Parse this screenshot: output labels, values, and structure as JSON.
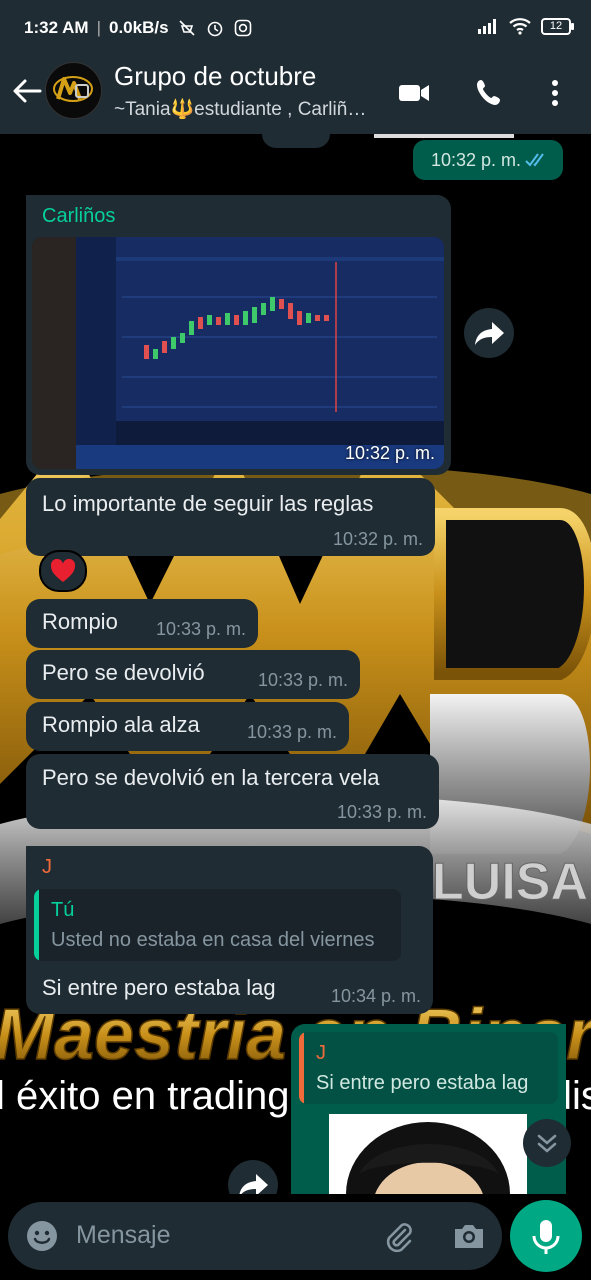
{
  "status_bar": {
    "time": "1:32 AM",
    "speed": "0.0kB/s",
    "battery": "12"
  },
  "header": {
    "title": "Grupo de octubre",
    "subtitle": "~Tania🔱estudiante , Carliñ…"
  },
  "messages": [
    {
      "kind": "outgoing_time",
      "time": "10:32 p. m."
    },
    {
      "kind": "image",
      "sender": "Carliños",
      "time": "10:32 p. m."
    },
    {
      "kind": "text",
      "text": "Lo importante de seguir las reglas",
      "time": "10:32 p. m.",
      "reaction": "❤️"
    },
    {
      "kind": "text",
      "text": "Rompio",
      "time": "10:33 p. m."
    },
    {
      "kind": "text",
      "text": "Pero  se devolvió",
      "time": "10:33 p. m."
    },
    {
      "kind": "text",
      "text": "Rompio ala alza",
      "time": "10:33 p. m."
    },
    {
      "kind": "text",
      "text": "Pero  se devolvió en la tercera vela",
      "time": "10:33 p. m."
    },
    {
      "kind": "reply",
      "sender": "J",
      "quote_author": "Tú",
      "quote_text": "Usted no estaba en casa del viernes",
      "text": "Si entre pero estaba lag",
      "time": "10:34 p. m."
    },
    {
      "kind": "outgoing_reply",
      "quote_author": "J",
      "quote_text": "Si entre pero estaba lag"
    }
  ],
  "wallpaper": {
    "line1": "Maestria en Binarias",
    "line2": "l éxito en trading se basa en la disciplina",
    "tag": "LUISA"
  },
  "input": {
    "placeholder": "Mensaje"
  },
  "colors": {
    "header_bg": "#1f2c34",
    "bubble_in": "#1f2c34",
    "bubble_out": "#005c4b",
    "accent": "#00a884",
    "read_ticks": "#53bdeb",
    "sender_green": "#06cf9c",
    "sender_orange": "#f06a3a"
  }
}
